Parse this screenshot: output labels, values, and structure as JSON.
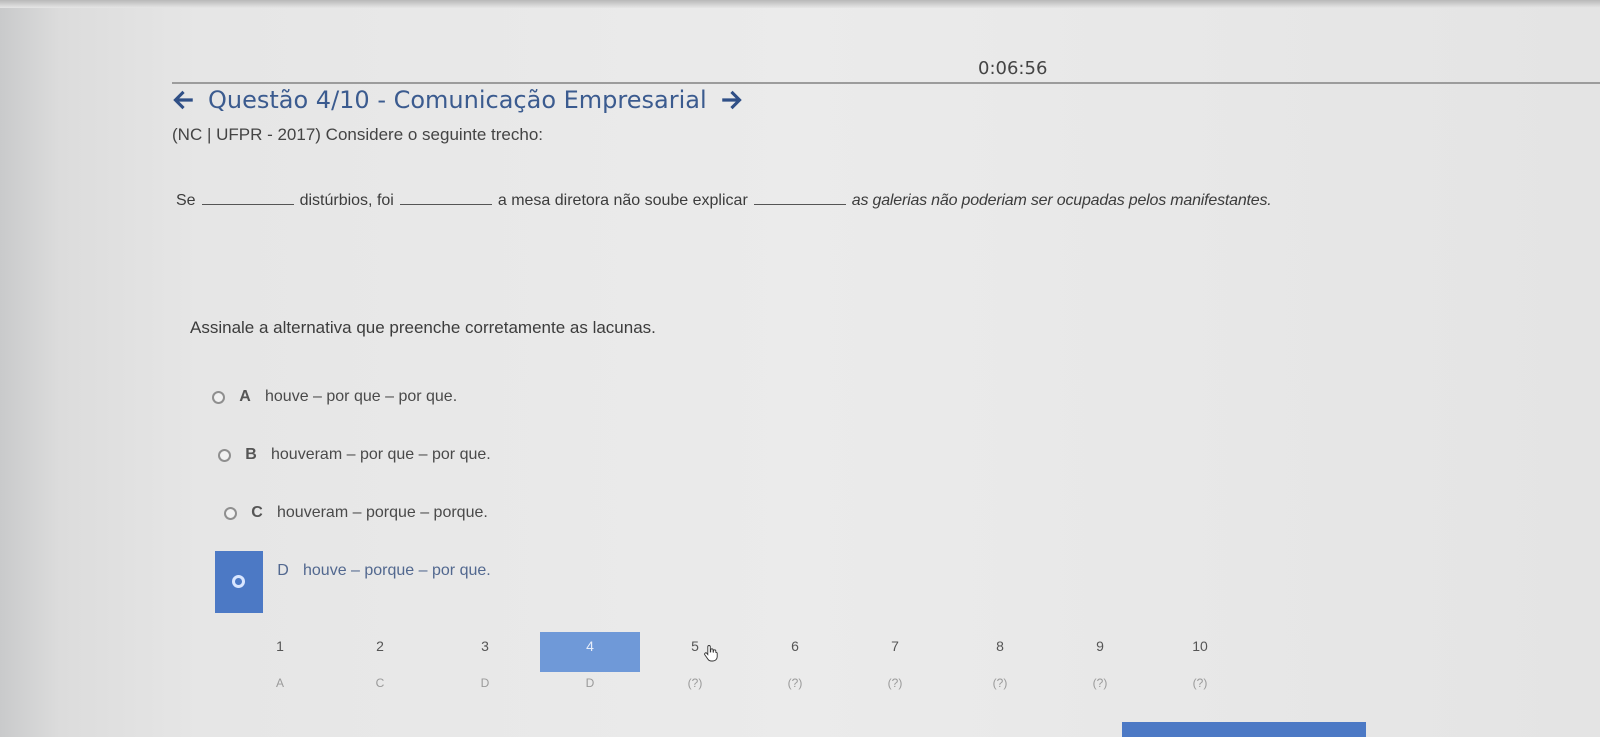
{
  "timer": "0:06:56",
  "question": {
    "title": "Questão 4/10 - Comunicação Empresarial",
    "source": "(NC | UFPR - 2017)  Considere o seguinte trecho:",
    "excerpt": {
      "part1": "Se",
      "part2": "distúrbios, foi",
      "part3": "a mesa diretora não soube explicar",
      "part4": "as galerias não poderiam ser ocupadas pelos manifestantes."
    },
    "prompt": "Assinale a alternativa que preenche corretamente as lacunas."
  },
  "options": [
    {
      "letter": "A",
      "text": "houve – por que – por que."
    },
    {
      "letter": "B",
      "text": "houveram – por que – por que."
    },
    {
      "letter": "C",
      "text": "houveram – porque – porque."
    },
    {
      "letter": "D",
      "text": "houve – porque – por que."
    }
  ],
  "selected_option": "D",
  "navigation": [
    {
      "number": "1",
      "answer": "A"
    },
    {
      "number": "2",
      "answer": "C"
    },
    {
      "number": "3",
      "answer": "D"
    },
    {
      "number": "4",
      "answer": "D"
    },
    {
      "number": "5",
      "answer": "(?)"
    },
    {
      "number": "6",
      "answer": "(?)"
    },
    {
      "number": "7",
      "answer": "(?)"
    },
    {
      "number": "8",
      "answer": "(?)"
    },
    {
      "number": "9",
      "answer": "(?)"
    },
    {
      "number": "10",
      "answer": "(?)"
    }
  ],
  "current_question": "4",
  "colors": {
    "accent": "#4c79c5",
    "title": "#3b5b8f",
    "current_tab": "#6f99d8"
  },
  "icons": {
    "prev": "arrow-left-icon",
    "next": "arrow-right-icon",
    "cursor": "hand-cursor-icon"
  }
}
